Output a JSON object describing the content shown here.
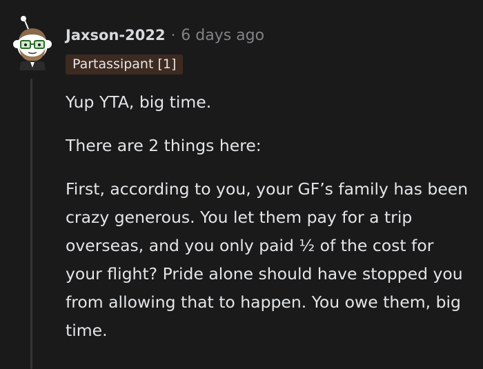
{
  "comment": {
    "author": "Jaxson-2022",
    "separator": "·",
    "timestamp": "6 days ago",
    "flair": "Partassipant [1]",
    "paragraphs": [
      "Yup YTA, big time.",
      "There are 2 things here:",
      "First, according to you, your GF’s family has been crazy generous. You let them pay for a trip overseas, and you only paid ½ of the cost for your flight? Pride alone should have stopped you from allowing that to happen. You owe them, big time."
    ]
  },
  "colors": {
    "background": "#1a1a1b",
    "text": "#d7dadc",
    "meta": "#818384",
    "flair_bg": "#3d2b21",
    "thread_line": "#343536"
  },
  "icons": {
    "avatar": "snoo-avatar-glasses-beard-icon"
  }
}
